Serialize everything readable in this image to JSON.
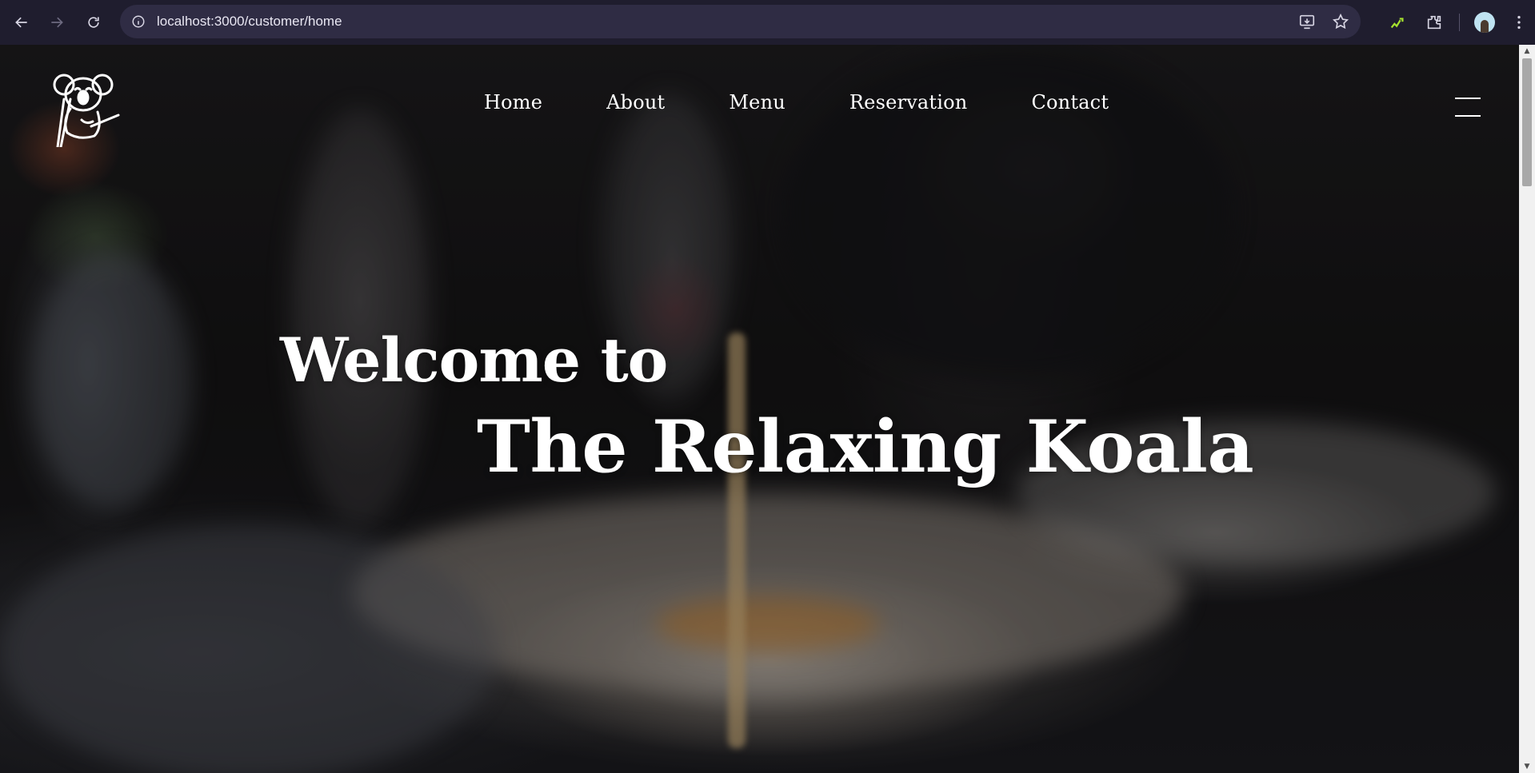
{
  "browser": {
    "url": "localhost:3000/customer/home",
    "icons": {
      "back": "arrow-left-icon",
      "forward": "arrow-right-icon",
      "reload": "reload-icon",
      "site_info": "site-info-icon",
      "install_app": "install-app-icon",
      "bookmark": "star-icon",
      "extension": "extension-icon",
      "puzzle": "puzzle-icon",
      "profile": "avatar",
      "menu": "kebab-menu-icon"
    }
  },
  "site": {
    "logo": "koala-logo",
    "nav": {
      "items": [
        "Home",
        "About",
        "Menu",
        "Reservation",
        "Contact"
      ]
    },
    "hero": {
      "welcome": "Welcome to",
      "brand": "The Relaxing Koala"
    }
  },
  "colors": {
    "chrome_bg": "#1f1d2e",
    "omnibox_bg": "#2f2c44",
    "hero_text": "#ffffff"
  }
}
